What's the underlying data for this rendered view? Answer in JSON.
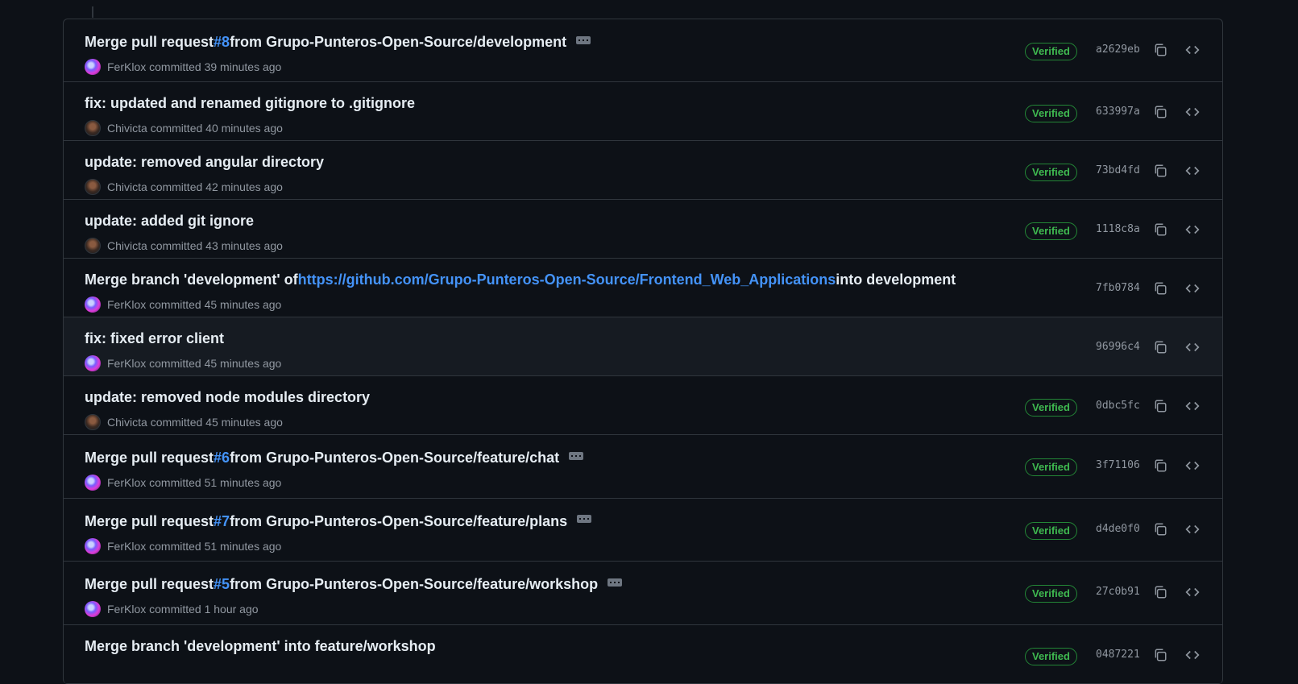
{
  "commits": [
    {
      "message_prefix": "Merge pull request ",
      "pr": "#8",
      "message_suffix": " from Grupo-Punteros-Open-Source/development",
      "author": "FerKlox",
      "committed": "committed",
      "time": "39 minutes ago",
      "verified": "Verified",
      "sha": "a2629eb"
    },
    {
      "message_prefix": "fix: updated and renamed gitignore to .gitignore",
      "pr": "",
      "message_suffix": "",
      "author": "Chivicta",
      "committed": "committed",
      "time": "40 minutes ago",
      "verified": "Verified",
      "sha": "633997a"
    },
    {
      "message_prefix": "update: removed angular directory",
      "pr": "",
      "message_suffix": "",
      "author": "Chivicta",
      "committed": "committed",
      "time": "42 minutes ago",
      "verified": "Verified",
      "sha": "73bd4fd"
    },
    {
      "message_prefix": "update: added git ignore",
      "pr": "",
      "message_suffix": "",
      "author": "Chivicta",
      "committed": "committed",
      "time": "43 minutes ago",
      "verified": "Verified",
      "sha": "1118c8a"
    },
    {
      "message_prefix": "Merge branch 'development' of ",
      "pr": "https://github.com/Grupo-Punteros-Open-Source/Frontend_Web_Applications",
      "message_suffix": " into development",
      "author": "FerKlox",
      "committed": "committed",
      "time": "45 minutes ago",
      "verified": "",
      "sha": "7fb0784"
    },
    {
      "message_prefix": "fix: fixed error client",
      "pr": "",
      "message_suffix": "",
      "author": "FerKlox",
      "committed": "committed",
      "time": "45 minutes ago",
      "verified": "",
      "sha": "96996c4"
    },
    {
      "message_prefix": "update: removed node modules directory",
      "pr": "",
      "message_suffix": "",
      "author": "Chivicta",
      "committed": "committed",
      "time": "45 minutes ago",
      "verified": "Verified",
      "sha": "0dbc5fc"
    },
    {
      "message_prefix": "Merge pull request ",
      "pr": "#6",
      "message_suffix": " from Grupo-Punteros-Open-Source/feature/chat",
      "author": "FerKlox",
      "committed": "committed",
      "time": "51 minutes ago",
      "verified": "Verified",
      "sha": "3f71106"
    },
    {
      "message_prefix": "Merge pull request ",
      "pr": "#7",
      "message_suffix": " from Grupo-Punteros-Open-Source/feature/plans",
      "author": "FerKlox",
      "committed": "committed",
      "time": "51 minutes ago",
      "verified": "Verified",
      "sha": "d4de0f0"
    },
    {
      "message_prefix": "Merge pull request ",
      "pr": "#5",
      "message_suffix": " from Grupo-Punteros-Open-Source/feature/workshop",
      "author": "FerKlox",
      "committed": "committed",
      "time": "1 hour ago",
      "verified": "Verified",
      "sha": "27c0b91"
    },
    {
      "message_prefix": "Merge branch 'development' into feature/workshop",
      "pr": "",
      "message_suffix": "",
      "author": "",
      "committed": "",
      "time": "",
      "verified": "Verified",
      "sha": "0487221"
    }
  ],
  "icons": {
    "copy": "copy-icon",
    "browse": "code-icon",
    "expand": "ellipsis-icon"
  },
  "colors": {
    "background": "#0d1117",
    "border": "#30363d",
    "link": "#4493f8",
    "verified": "#3fb950"
  }
}
